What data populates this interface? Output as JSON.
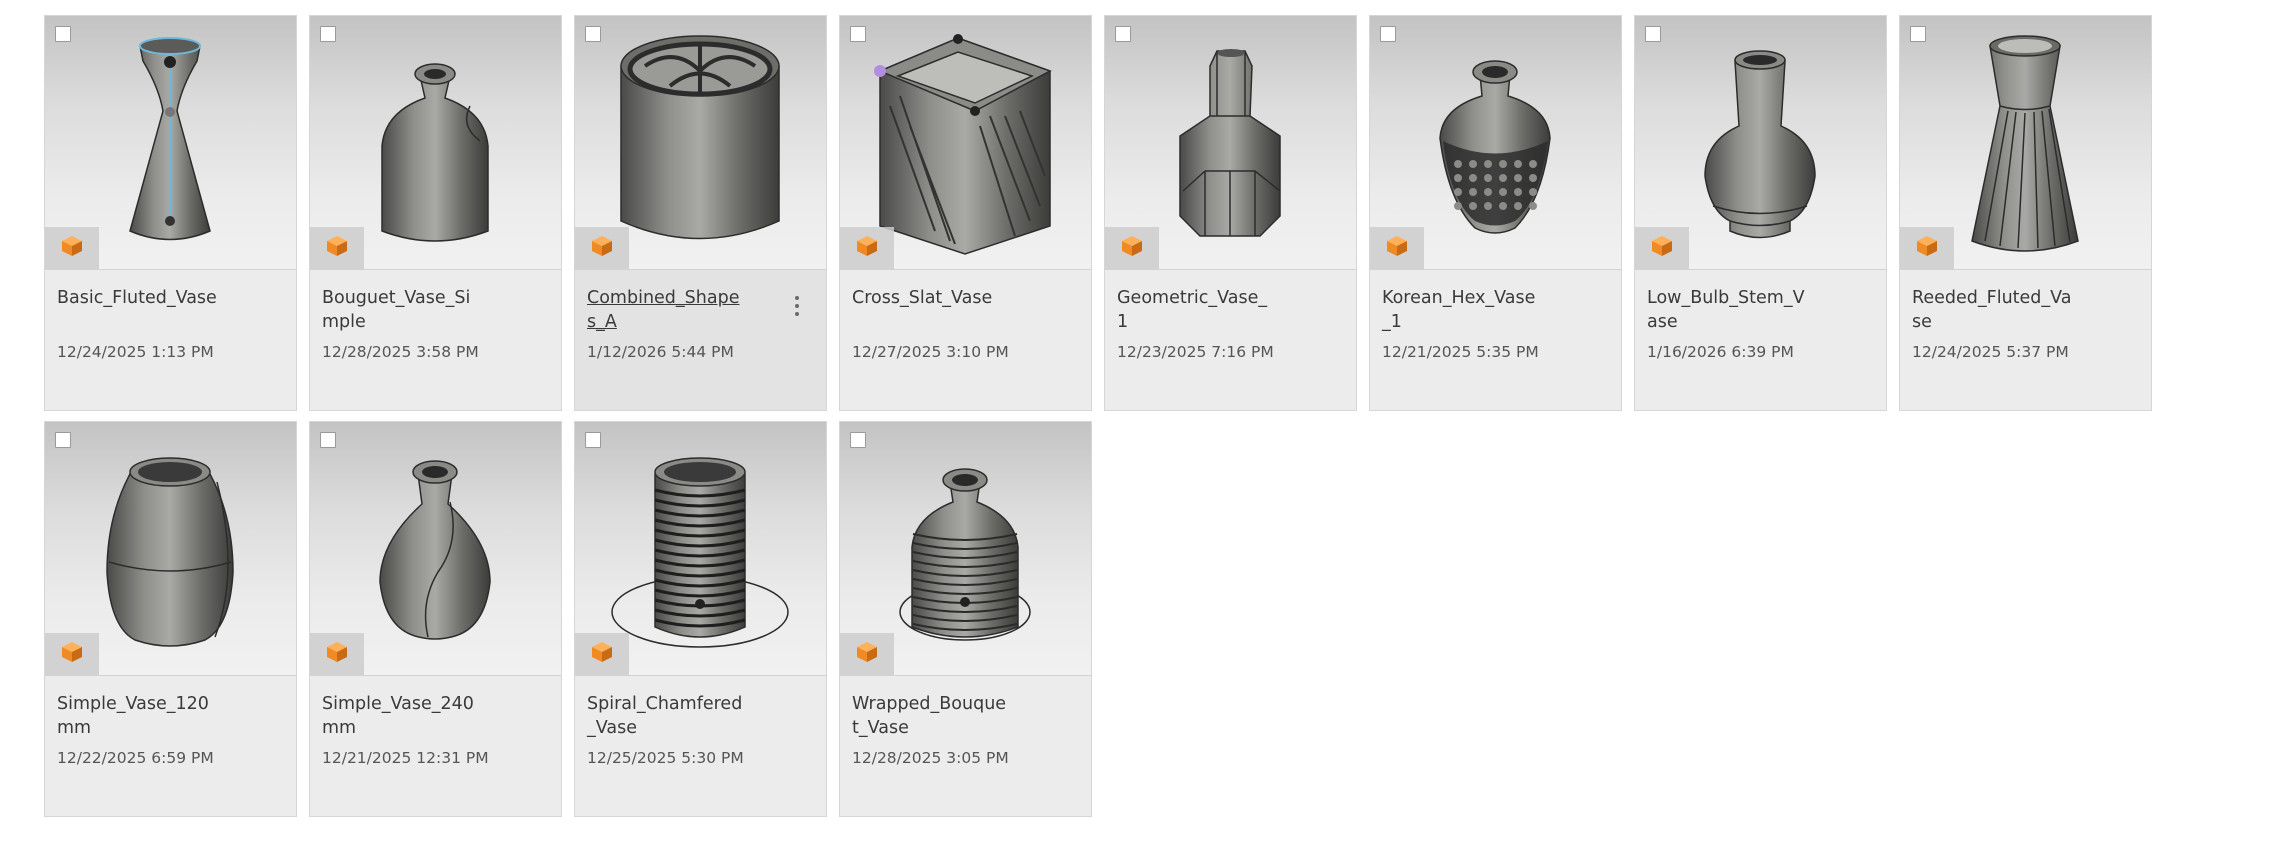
{
  "files": [
    {
      "name": "Basic_Fluted_Vase",
      "date": "12/24/2025 1:13 PM",
      "thumbnail": "basic-fluted-vase",
      "type_icon": "design-cube-icon"
    },
    {
      "name": "Bouguet_Vase_Simple",
      "date": "12/28/2025 3:58 PM",
      "thumbnail": "bouguet-vase-simple",
      "type_icon": "design-cube-icon"
    },
    {
      "name": "Combined_Shapes_A",
      "date": "1/12/2026 5:44 PM",
      "thumbnail": "combined-shapes-a",
      "type_icon": "design-cube-icon",
      "hovered": true
    },
    {
      "name": "Cross_Slat_Vase",
      "date": "12/27/2025 3:10 PM",
      "thumbnail": "cross-slat-vase",
      "type_icon": "design-cube-icon"
    },
    {
      "name": "Geometric_Vase_1",
      "date": "12/23/2025 7:16 PM",
      "thumbnail": "geometric-vase",
      "type_icon": "design-cube-icon"
    },
    {
      "name": "Korean_Hex_Vase_1",
      "date": "12/21/2025 5:35 PM",
      "thumbnail": "korean-hex-vase",
      "type_icon": "design-cube-icon"
    },
    {
      "name": "Low_Bulb_Stem_Vase",
      "date": "1/16/2026 6:39 PM",
      "thumbnail": "low-bulb-stem-vase",
      "type_icon": "design-cube-icon"
    },
    {
      "name": "Reeded_Fluted_Vase",
      "date": "12/24/2025 5:37 PM",
      "thumbnail": "reeded-fluted-vase",
      "type_icon": "design-cube-icon"
    },
    {
      "name": "Simple_Vase_120mm",
      "date": "12/22/2025 6:59 PM",
      "thumbnail": "simple-vase-120",
      "type_icon": "design-cube-icon"
    },
    {
      "name": "Simple_Vase_240mm",
      "date": "12/21/2025 12:31 PM",
      "thumbnail": "simple-vase-240",
      "type_icon": "design-cube-icon"
    },
    {
      "name": "Spiral_Chamfered_Vase",
      "date": "12/25/2025 5:30 PM",
      "thumbnail": "spiral-chamfered-vase",
      "type_icon": "design-cube-icon"
    },
    {
      "name": "Wrapped_Bouquet_Vase",
      "date": "12/28/2025 3:05 PM",
      "thumbnail": "wrapped-bouquet-vase",
      "type_icon": "design-cube-icon"
    }
  ],
  "colors": {
    "card_background": "#ececec",
    "badge_orange": "#f08a24",
    "model_grey": "#7b7b78"
  }
}
